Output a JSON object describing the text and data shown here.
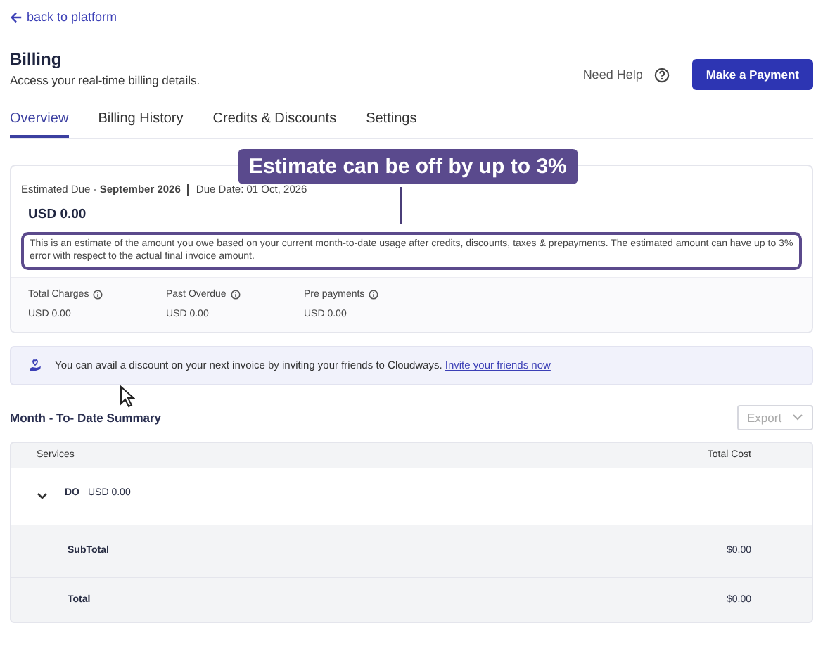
{
  "back_link": "back to platform",
  "header": {
    "title": "Billing",
    "subtitle": "Access your real-time billing details.",
    "help": "Need Help",
    "button": "Make a Payment"
  },
  "tabs": [
    {
      "label": "Overview",
      "selected": true
    },
    {
      "label": "Billing History",
      "selected": false
    },
    {
      "label": "Credits & Discounts",
      "selected": false
    },
    {
      "label": "Settings",
      "selected": false
    }
  ],
  "estimate": {
    "label": "Estimated Due - **September 2026**",
    "due_date": "Due Date: 01 Oct, 2026",
    "amount": "USD 0.00",
    "note": "This is an estimate of the amount you owe based on your current month-to-date usage after credits, discounts, taxes & prepayments. The estimated amount can have up to 3% error with respect to the actual final invoice amount.",
    "tooltip": "Estimate can be off by up to 3%",
    "stats": [
      {
        "label": "Total Charges",
        "value": "USD 0.00"
      },
      {
        "label": "Past Overdue",
        "value": "USD 0.00"
      },
      {
        "label": "Pre payments",
        "value": "USD 0.00"
      }
    ]
  },
  "banner": {
    "text": "You can avail a discount on your next invoice by inviting your friends to Cloudways.",
    "link": "Invite your friends now"
  },
  "summary": {
    "title": "Month - To- Date Summary",
    "export": "Export",
    "columns": [
      "Services",
      "Total Cost"
    ],
    "services": [
      {
        "name": "DO",
        "amount": "USD 0.00",
        "expanded": false
      }
    ],
    "totals": [
      {
        "label": "SubTotal",
        "value": "$0.00"
      },
      {
        "label": "Total",
        "value": "$0.00"
      }
    ]
  }
}
